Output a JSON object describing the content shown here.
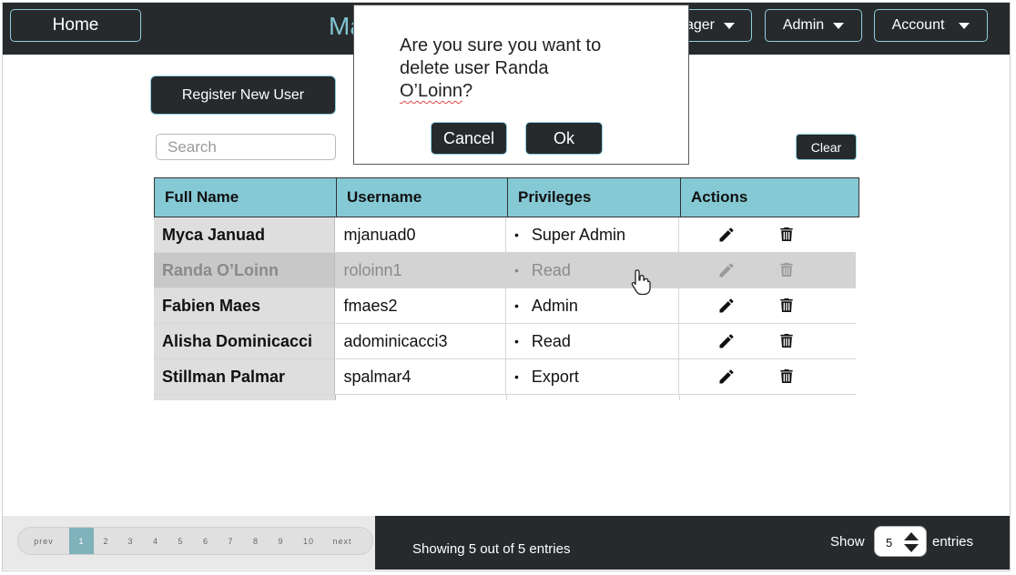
{
  "nav": {
    "home": "Home",
    "title_peek": "Ma",
    "manager": "ager",
    "admin": "Admin",
    "account": "Account"
  },
  "toolbar": {
    "register": "Register New User",
    "search_placeholder": "Search",
    "clear": "Clear"
  },
  "table": {
    "headers": [
      "Full Name",
      "Username",
      "Privileges",
      "Actions"
    ],
    "rows": [
      {
        "name": "Myca Januad",
        "username": "mjanuad0",
        "privilege": "Super Admin"
      },
      {
        "name": "Randa O’Loinn",
        "username": "roloinn1",
        "privilege": "Read"
      },
      {
        "name": "Fabien Maes",
        "username": "fmaes2",
        "privilege": "Admin"
      },
      {
        "name": "Alisha Dominicacci",
        "username": "adominicacci3",
        "privilege": "Read"
      },
      {
        "name": "Stillman Palmar",
        "username": "spalmar4",
        "privilege": "Export"
      }
    ],
    "icons": [
      "pencil-icon",
      "trash-icon"
    ]
  },
  "dialog": {
    "message_line1": "Are you sure you want to",
    "message_line2": "delete user Randa",
    "message_name": "O’Loinn",
    "message_end": "?",
    "cancel": "Cancel",
    "ok": "Ok"
  },
  "footer": {
    "prev": "prev",
    "pages": [
      "1",
      "2",
      "3",
      "4",
      "5",
      "6",
      "7",
      "8",
      "9",
      "10"
    ],
    "next": "next",
    "showing": "Showing 5 out of 5 entries",
    "show": "Show",
    "entries_value": "5",
    "entries": "entries"
  },
  "colors": {
    "bar": "#272a2c",
    "accent": "#85c9d5",
    "button_border": "#8fcfe0"
  }
}
